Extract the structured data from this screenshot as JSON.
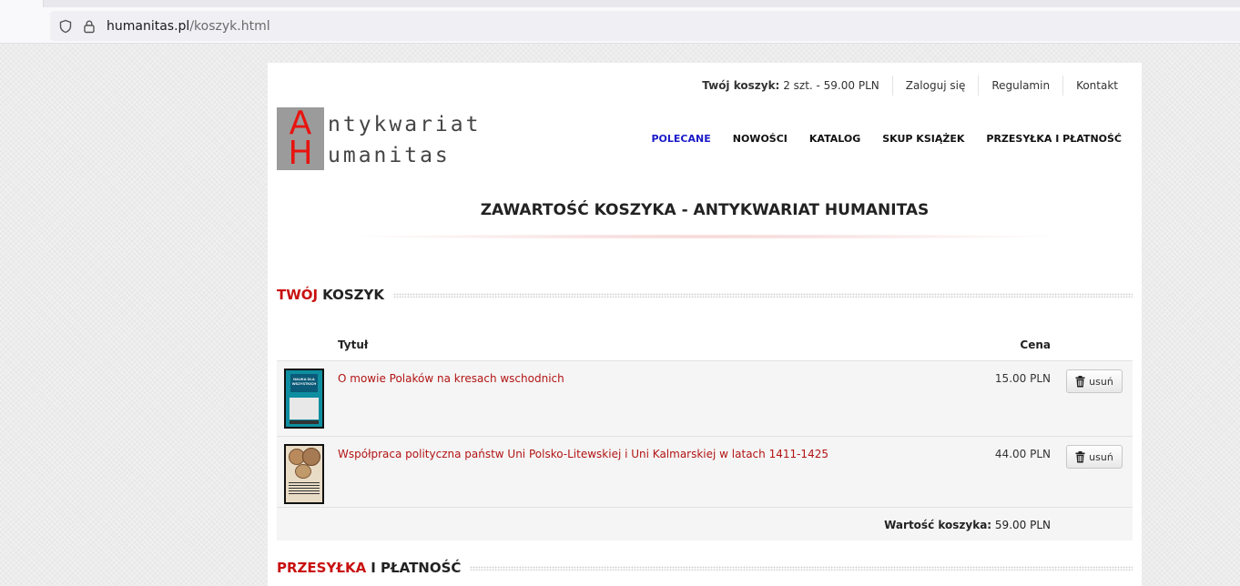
{
  "browser": {
    "url_host": "humanitas.pl",
    "url_path": "/koszyk.html"
  },
  "topbar": {
    "cart_label": "Twój koszyk:",
    "cart_value": "2 szt. - 59.00 PLN",
    "login": "Zaloguj się",
    "terms": "Regulamin",
    "contact": "Kontakt"
  },
  "logo": {
    "letter_a": "A",
    "letter_h": "H",
    "line1": "ntykwariat",
    "line2": "umanitas"
  },
  "nav": {
    "items": [
      "POLECANE",
      "NOWOŚCI",
      "KATALOG",
      "SKUP KSIĄŻEK",
      "PRZESYŁKA I PŁATNOŚĆ"
    ],
    "active_color": "#1a1ac8"
  },
  "page_title": "ZAWARTOŚĆ KOSZYKA - ANTYKWARIAT HUMANITAS",
  "cart_section": {
    "head_red": "TWÓJ",
    "head_rest": "KOSZYK"
  },
  "table": {
    "col_title": "Tytuł",
    "col_price": "Cena",
    "rows": [
      {
        "title": "O mowie Polaków na kresach wschodnich",
        "price": "15.00 PLN",
        "remove": "usuń",
        "cover": {
          "text": "NAUKA DLA WSZYSTKICH"
        }
      },
      {
        "title": "Współpraca polityczna państw Uni Polsko-Litewskiej i Uni Kalmarskiej w latach 1411-1425",
        "price": "44.00 PLN",
        "remove": "usuń"
      }
    ],
    "total_label": "Wartość koszyka:",
    "total_value": "59.00 PLN"
  },
  "shipping_section": {
    "head_red": "PRZESYŁKA",
    "head_rest": "I PŁATNOŚĆ"
  },
  "colors": {
    "accent_red": "#c81010",
    "link_red": "#b31414"
  }
}
